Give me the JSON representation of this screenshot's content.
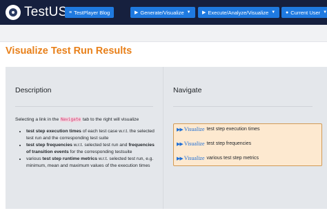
{
  "navbar": {
    "brand": "TestUS",
    "buttons": [
      {
        "label": "TestPlayer Blog",
        "icon": "rss-icon"
      },
      {
        "label": "Generate/Visualize",
        "icon": "play-icon"
      },
      {
        "label": "Execute/Analyze/Visualize",
        "icon": "play-icon"
      },
      {
        "label": "Current User",
        "icon": "user-icon"
      }
    ]
  },
  "page": {
    "title": "Visualize Test Run Results"
  },
  "description": {
    "heading": "Description",
    "intro_before": "Selecting a link in the ",
    "intro_code": "Navigate",
    "intro_after": " tab to the right will visualize",
    "items": [
      {
        "bold": "test step execution times",
        "text": " of each test case w.r.t. the selected test run and the corresponding test suite"
      },
      {
        "bold": "test step frequencies",
        "text": " w.r.t. selected test run and ",
        "bold2": "frequencies of transition events",
        "text2": " for the corresponding testsuite"
      },
      {
        "pre": "various ",
        "bold": "test step runtime metrics",
        "text": " w.r.t. selected test run, e.g. minimum, mean and maximum values of the execution times"
      }
    ]
  },
  "navigate": {
    "heading": "Navigate",
    "links": [
      {
        "link": "Visualize",
        "text": "test step execution times"
      },
      {
        "link": "Visualize",
        "text": "test step frequencies"
      },
      {
        "link": "Visualize",
        "text": "various test step metrics"
      }
    ]
  },
  "colors": {
    "navbar_bg": "#16203e",
    "button_bg": "#1f7ae0",
    "title_orange": "#e8801a",
    "panel_bg": "#e4e7eb",
    "nav_box_bg": "#fde9d0",
    "link_blue": "#1f6fd6"
  }
}
